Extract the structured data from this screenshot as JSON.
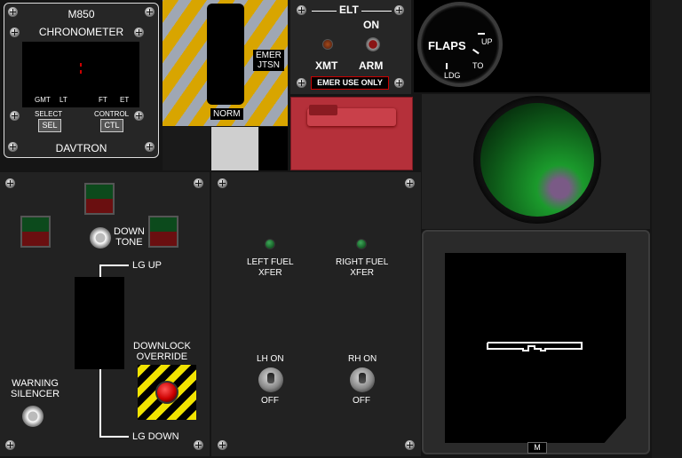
{
  "chronometer": {
    "model": "M850",
    "title": "CHRONOMETER",
    "modes": [
      "GMT",
      "LT",
      "FT",
      "ET"
    ],
    "select_label": "SELECT",
    "select_button": "SEL",
    "control_label": "CONTROL",
    "control_button": "CTL",
    "brand": "DAVTRON"
  },
  "emer_jettison": {
    "emer_label": "EMER",
    "jtsn_label": "JTSN",
    "norm_label": "NORM"
  },
  "elt": {
    "title": "ELT",
    "on_label": "ON",
    "xmt_label": "XMT",
    "arm_label": "ARM",
    "emer_use": "EMER USE ONLY"
  },
  "flaps": {
    "title": "FLAPS",
    "up": "UP",
    "to": "TO",
    "ldg": "LDG"
  },
  "gear": {
    "down_tone": "DOWN\nTONE",
    "lg_up": "LG UP",
    "lg_down": "LG DOWN",
    "downlock_override": "DOWNLOCK\nOVERRIDE",
    "warning_silencer": "WARNING\nSILENCER"
  },
  "fuel": {
    "left_xfer": "LEFT FUEL\nXFER",
    "right_xfer": "RIGHT FUEL\nXFER",
    "lh_on": "LH ON",
    "rh_on": "RH ON",
    "off_left": "OFF",
    "off_right": "OFF"
  },
  "mfd": {
    "m_button": "M"
  },
  "colors": {
    "panel": "#222222",
    "hazard_yellow": "#f2c200",
    "lamp_green": "#0c4a1c",
    "lamp_red": "#6a0f10",
    "guard_red": "#b5303a",
    "crt_green": "#1b9a2c"
  }
}
